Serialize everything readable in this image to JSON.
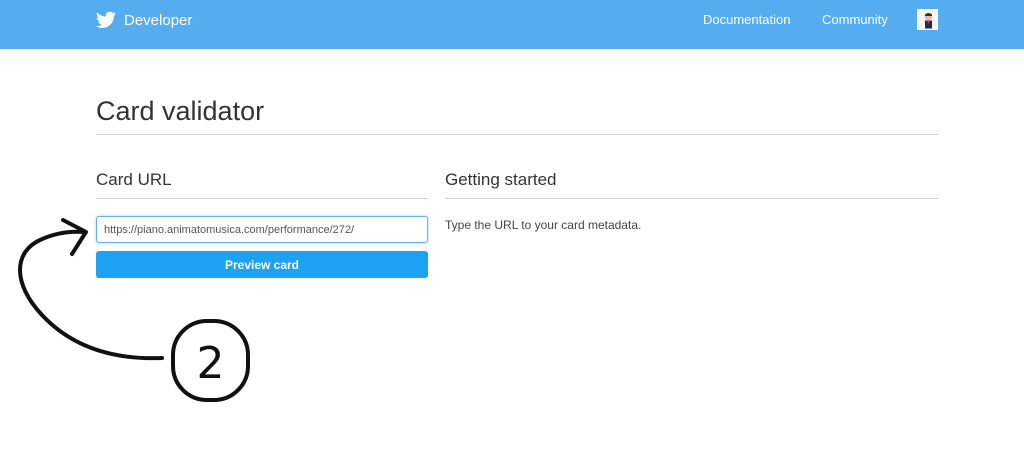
{
  "header": {
    "brand_label": "Developer",
    "nav": {
      "documentation": "Documentation",
      "community": "Community"
    },
    "background_color": "#55acee"
  },
  "page": {
    "title": "Card validator"
  },
  "card_url": {
    "heading": "Card URL",
    "input_value": "https://piano.animatomusica.com/performance/272/",
    "button_label": "Preview card"
  },
  "getting_started": {
    "heading": "Getting started",
    "text": "Type the URL to your card metadata."
  },
  "annotation": {
    "step_number": "2",
    "icon": "curved-arrow-icon"
  },
  "colors": {
    "accent": "#1da1f2",
    "input_focus": "#66afe9"
  }
}
